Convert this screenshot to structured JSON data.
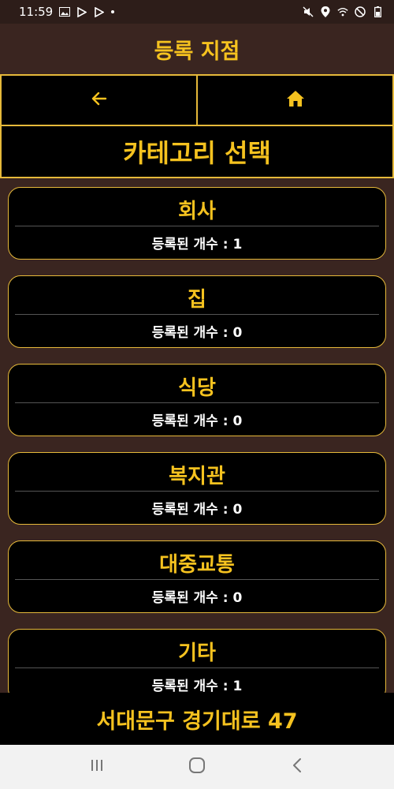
{
  "status_bar": {
    "time": "11:59"
  },
  "header": {
    "title": "등록 지점"
  },
  "nav": {
    "back_icon": "arrow-left-icon",
    "home_icon": "home-icon"
  },
  "section": {
    "title": "카테고리 선택"
  },
  "categories": [
    {
      "name": "회사",
      "count_label": "등록된 개수 : 1"
    },
    {
      "name": "집",
      "count_label": "등록된 개수 : 0"
    },
    {
      "name": "식당",
      "count_label": "등록된 개수 : 0"
    },
    {
      "name": "복지관",
      "count_label": "등록된 개수 : 0"
    },
    {
      "name": "대중교통",
      "count_label": "등록된 개수 : 0"
    },
    {
      "name": "기타",
      "count_label": "등록된 개수 : 1"
    }
  ],
  "footer": {
    "address": "서대문구 경기대로 47"
  },
  "colors": {
    "accent": "#f5c21f",
    "border": "#e6b93a",
    "background": "#3a2520",
    "card": "#000000"
  }
}
